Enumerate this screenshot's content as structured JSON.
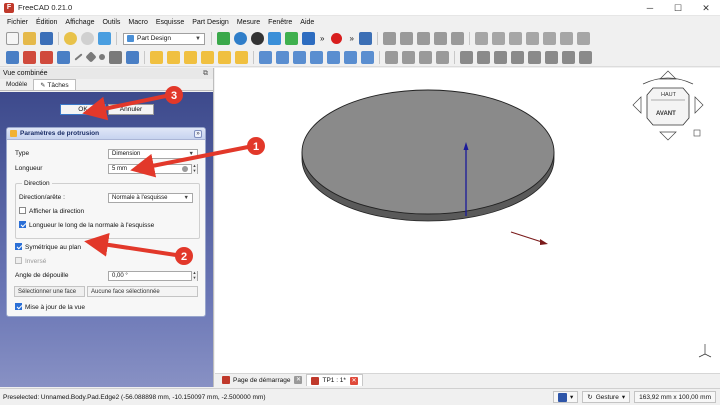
{
  "window": {
    "title": "FreeCAD 0.21.0",
    "controls": {
      "minimize": "─",
      "maximize": "☐",
      "close": "✕"
    }
  },
  "menu": [
    "Fichier",
    "Édition",
    "Affichage",
    "Outils",
    "Macro",
    "Esquisse",
    "Part Design",
    "Mesure",
    "Fenêtre",
    "Aide"
  ],
  "toolbar": {
    "workbench": "Part Design",
    "overflow": "»"
  },
  "combo_view": {
    "title": "Vue combinée",
    "tabs": [
      "Modèle",
      "Tâches"
    ],
    "active_tab": "Tâches",
    "ok_label": "OK",
    "cancel_label": "Annuler",
    "task_title": "Paramètres de protrusion",
    "collapse_glyph": "»",
    "type_label": "Type",
    "type_value": "Dimension",
    "length_label": "Longueur",
    "length_value": "5 mm",
    "direction_group": "Direction",
    "direction_edge_label": "Direction/arête :",
    "direction_edge_value": "Normale à l'esquisse",
    "show_direction": "Afficher la direction",
    "length_along_normal": "Longueur le long de la normale à l'esquisse",
    "symmetric": "Symétrique au plan",
    "reversed": "Inversé",
    "taper_label": "Angle de dépouille",
    "taper_value": "0,00 °",
    "select_face": "Sélectionner une face",
    "no_face_selected": "Aucune face sélectionnée",
    "update_view": "Mise à jour de la vue"
  },
  "annotations": [
    "1",
    "2",
    "3"
  ],
  "view3d": {
    "navcube_faces": [
      "HAUT",
      "AVANT"
    ]
  },
  "document_tabs": [
    {
      "label": "Page de démarrage",
      "active": false
    },
    {
      "label": "TP1 : 1*",
      "active": true
    }
  ],
  "status": {
    "message": "Preselected: Unnamed.Body.Pad.Edge2 (-56.088898 mm, -10.150097 mm, -2.500000 mm)",
    "navigation": "Gesture",
    "dimensions": "163,92 mm x 100,00 mm"
  },
  "colors": {
    "accent_red": "#e2382a",
    "task_gradient_top": "#3d4a8c",
    "axis_blue": "#1a1a9a"
  }
}
